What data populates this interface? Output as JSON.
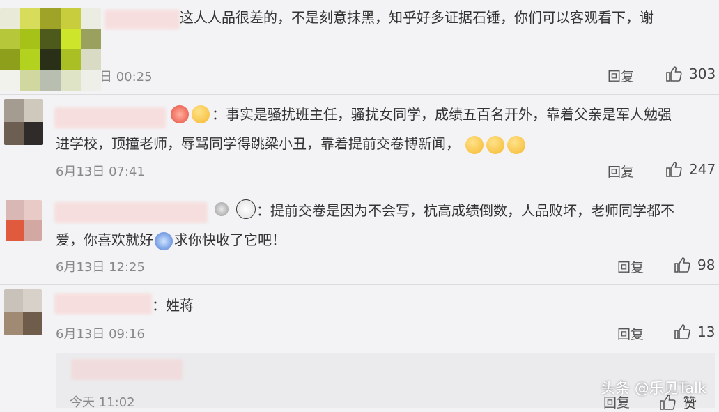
{
  "comments": [
    {
      "text": "这人人品很差的，不是刻意抹黑，知乎好多证据石锤，你们可以客观看下，谢",
      "time": "日 00:25",
      "reply": "回复",
      "likes": "303"
    },
    {
      "text_line1": "：事实是骚扰班主任，骚扰女同学，成绩五百名开外，靠着父亲是军人勉强",
      "text_line2": "进学校，顶撞老师，辱骂同学得跳梁小丑，靠着提前交卷博新闻，",
      "time": "6月13日 07:41",
      "reply": "回复",
      "likes": "247"
    },
    {
      "text_line1": "：提前交卷是因为不会写，杭高成绩倒数，人品败坏，老师同学都不",
      "text_line2a": "爱，你喜欢就好",
      "text_line2b": "求你快收了它吧！",
      "time": "6月13日 12:25",
      "reply": "回复",
      "likes": "98"
    },
    {
      "text": "：姓蒋",
      "time": "6月13日 09:16",
      "reply": "回复",
      "likes": "13"
    },
    {
      "time": "今天 11:02",
      "reply": "回复",
      "likes": "赞"
    }
  ],
  "watermark": "头条 @乐见Talk",
  "icons": {
    "like": "thumbs-up-icon",
    "emoji": "emoji-icon"
  },
  "colors": {
    "background": "#f3f3f5",
    "text": "#333333",
    "meta": "#888888"
  }
}
